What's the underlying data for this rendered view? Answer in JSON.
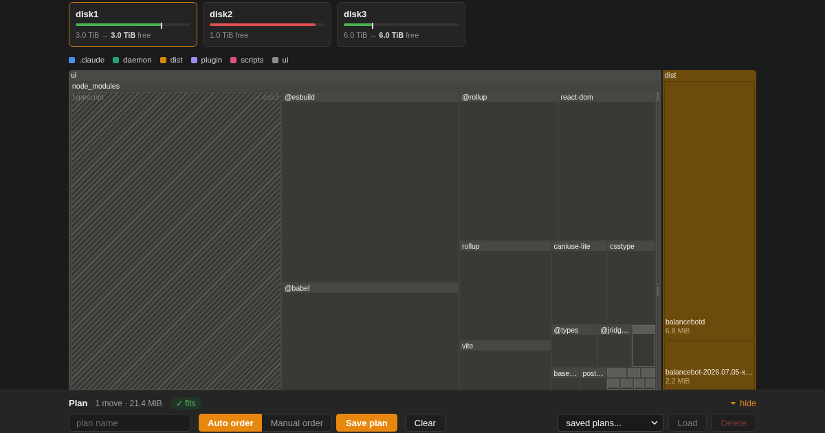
{
  "disks": [
    {
      "name": "disk1",
      "level": 0.75,
      "marker": true,
      "critical": false,
      "selected": true,
      "summary": "3.0 TiB → **3.0 TiB** free"
    },
    {
      "name": "disk2",
      "level": 0.92,
      "marker": false,
      "critical": true,
      "selected": false,
      "summary": "1.0 TiB free"
    },
    {
      "name": "disk3",
      "level": 0.25,
      "marker": true,
      "critical": false,
      "selected": false,
      "summary": "6.0 TiB → **6.0 TiB** free"
    }
  ],
  "legend": [
    {
      "label": ".claude",
      "color": "#4a8fe7"
    },
    {
      "label": "daemon",
      "color": "#1fa37a"
    },
    {
      "label": "dist",
      "color": "#d88a0b"
    },
    {
      "label": "plugin",
      "color": "#9e8cf2"
    },
    {
      "label": "scripts",
      "color": "#e0507f"
    },
    {
      "label": "ui",
      "color": "#8d8c87"
    }
  ],
  "treemap": {
    "nodes": [
      {
        "label": "ui",
        "color": "#4b4945",
        "children": [
          {
            "label": "node_modules",
            "children": [
              {
                "label": "typescript",
                "kind": "folder",
                "moved": true,
                "destination": "→ disk3"
              },
              {
                "label": "@esbuild",
                "kind": "folder",
                "moved": false
              },
              {
                "label": "@babel",
                "kind": "folder",
                "moved": false
              },
              {
                "label": "@rollup",
                "kind": "folder",
                "moved": false
              },
              {
                "label": "react-dom",
                "kind": "folder",
                "moved": false
              },
              {
                "label": "rollup",
                "kind": "folder",
                "moved": false
              },
              {
                "label": "vite",
                "kind": "folder",
                "moved": false
              },
              {
                "label": "caniuse-lite",
                "kind": "folder",
                "moved": false
              },
              {
                "label": "csstype",
                "kind": "folder",
                "moved": false
              },
              {
                "label": "@types",
                "kind": "folder",
                "moved": false
              },
              {
                "label": "@jridg…",
                "kind": "folder",
                "moved": false
              },
              {
                "label": "base…",
                "kind": "folder",
                "moved": false
              },
              {
                "label": "post…",
                "kind": "folder",
                "moved": false
              }
            ]
          }
        ]
      },
      {
        "label": "dist",
        "color": "#6c4b0d",
        "children": [
          {
            "label": "balancebotd",
            "kind": "file",
            "size": "6.8 MiB"
          },
          {
            "label": "balancebot-2026.07.05-x…",
            "kind": "file",
            "size": "2.2 MiB"
          }
        ]
      }
    ]
  },
  "plan": {
    "title": "Plan",
    "summary": "1 move · 21.4 MiB",
    "status": {
      "label": "✓ fits",
      "ok": true
    },
    "toggle": "hide",
    "name_field": {
      "placeholder": "plan name"
    },
    "order_modes": [
      {
        "label": "Auto order",
        "selected": true
      },
      {
        "label": "Manual order",
        "selected": false
      }
    ],
    "actions": [
      {
        "label": "Save plan",
        "kind": "primary"
      },
      {
        "label": "Clear",
        "kind": "secondary"
      }
    ],
    "saved_plans": {
      "value": "saved plans..."
    },
    "plan_actions": [
      {
        "label": "Load",
        "kind": "neutral",
        "disabled": true
      },
      {
        "label": "Delete",
        "kind": "danger",
        "disabled": true
      }
    ]
  }
}
